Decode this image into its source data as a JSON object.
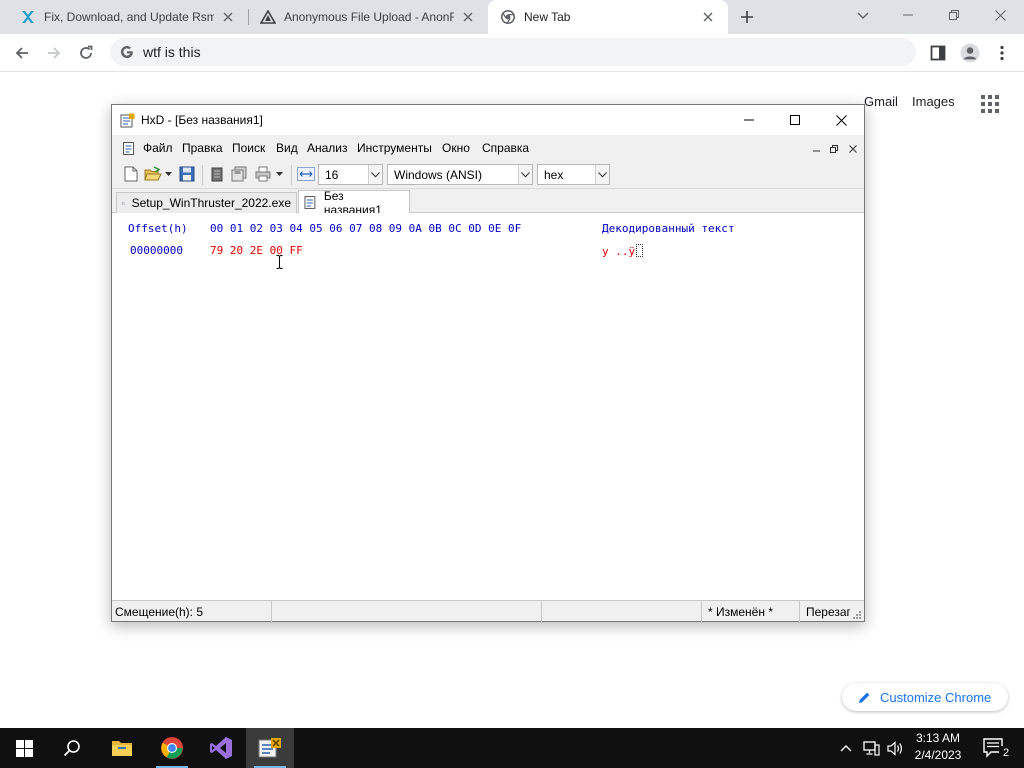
{
  "browser": {
    "tabs": [
      {
        "title": "Fix, Download, and Update Rsm.exe",
        "icon": "x-logo-icon"
      },
      {
        "title": "Anonymous File Upload - AnonFiles",
        "icon": "anonfiles-icon"
      },
      {
        "title": "New Tab",
        "icon": "chrome-icon"
      }
    ],
    "omnibox_text": "wtf is this"
  },
  "ntp": {
    "gmail": "Gmail",
    "images": "Images",
    "customize": "Customize Chrome"
  },
  "hxd": {
    "title": "HxD - [Без названия1]",
    "menu": [
      "Файл",
      "Правка",
      "Поиск",
      "Вид",
      "Анализ",
      "Инструменты",
      "Окно",
      "Справка"
    ],
    "bytes_per_row": "16",
    "charset": "Windows (ANSI)",
    "base": "hex",
    "file_tabs": [
      "Setup_WinThruster_2022.exe",
      "Без названия1"
    ],
    "header_offset": "Offset(h)",
    "header_columns": "00 01 02 03 04 05 06 07 08 09 0A 0B 0C 0D 0E 0F",
    "header_text": "Декодированный текст",
    "row_offset": "00000000",
    "row_bytes": "79 20 2E 00 FF",
    "row_text": "y .",
    "row_text_tail": ".ÿ",
    "status": {
      "offset": "Смещение(h): 5",
      "modified": "* Изменён *",
      "mode": "Перезапись"
    }
  },
  "taskbar": {
    "time": "3:13 AM",
    "date": "2/4/2023",
    "notifications": "2"
  },
  "colors": {
    "chrome_tabstrip": "#dee1e6",
    "hex_offset_blue": "#0000c0",
    "hex_byte_red": "#e00000",
    "link_blue": "#1a73e8",
    "taskbar": "#101010"
  }
}
